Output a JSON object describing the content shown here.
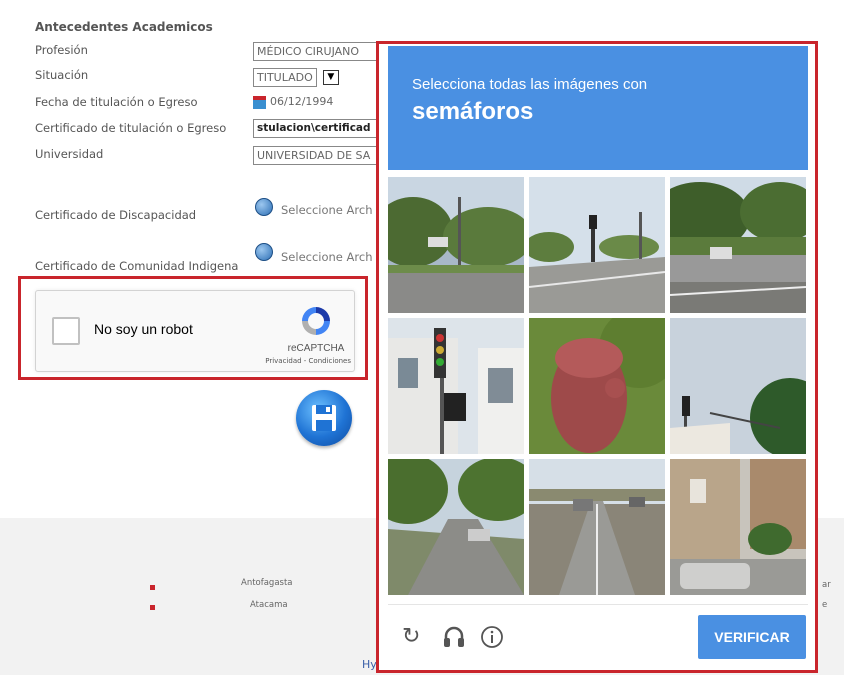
{
  "form": {
    "section_title": "Antecedentes Academicos",
    "labels": {
      "profesion": "Profesión",
      "situacion": "Situación",
      "fecha": "Fecha de titulación o Egreso",
      "certificado": "Certificado de titulación o Egreso",
      "universidad": "Universidad",
      "discapacidad": "Certificado de Discapacidad",
      "indigena": "Certificado de Comunidad Indigena"
    },
    "values": {
      "profesion": "MÉDICO CIRUJANO",
      "situacion": "TITULADO",
      "fecha": "06/12/1994",
      "certificado": "stulacion\\certificad",
      "universidad": "UNIVERSIDAD DE SA"
    },
    "file_button": "Seleccione Arch"
  },
  "recaptcha": {
    "label": "No soy un robot",
    "brand": "reCAPTCHA",
    "terms": "Privacidad - Condiciones"
  },
  "footer": {
    "city1": "Antofagasta",
    "city2": "Atacama",
    "link": "Hyperlink",
    "edge1": "ar",
    "edge2": "e"
  },
  "challenge": {
    "prompt": "Selecciona todas las imágenes con",
    "object": "semáforos",
    "verify_label": "VERIFICAR",
    "icons": [
      "reload-icon",
      "audio-icon",
      "info-icon"
    ]
  },
  "colors": {
    "accent_blue": "#4a90e2",
    "highlight_red": "#c9252c"
  }
}
